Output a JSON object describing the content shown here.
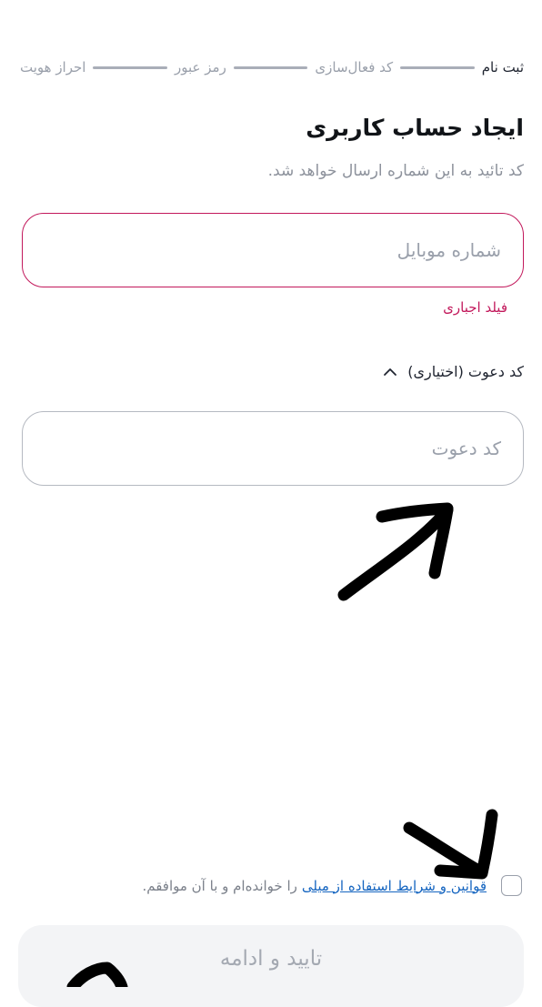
{
  "stepper": {
    "steps": [
      "ثبت نام",
      "کد فعال‌سازی",
      "رمز عبور",
      "احراز هویت"
    ]
  },
  "header": {
    "title": "ایجاد حساب کاربری",
    "subtitle": "کد تائید به این شماره ارسال خواهد شد."
  },
  "phone": {
    "placeholder": "شماره موبایل",
    "error": "فیلد اجباری"
  },
  "invite": {
    "toggle_label": "کد دعوت (اختیاری)",
    "placeholder": "کد دعوت"
  },
  "terms": {
    "link_text": "قوانین و شرایط استفاده از میلی",
    "suffix": "را خوانده‌ام و با آن موافقم."
  },
  "submit": {
    "label": "تایید و ادامه"
  },
  "colors": {
    "error": "#c2185b",
    "link": "#1565c0",
    "disabled_button_bg": "#f3f4f6"
  }
}
